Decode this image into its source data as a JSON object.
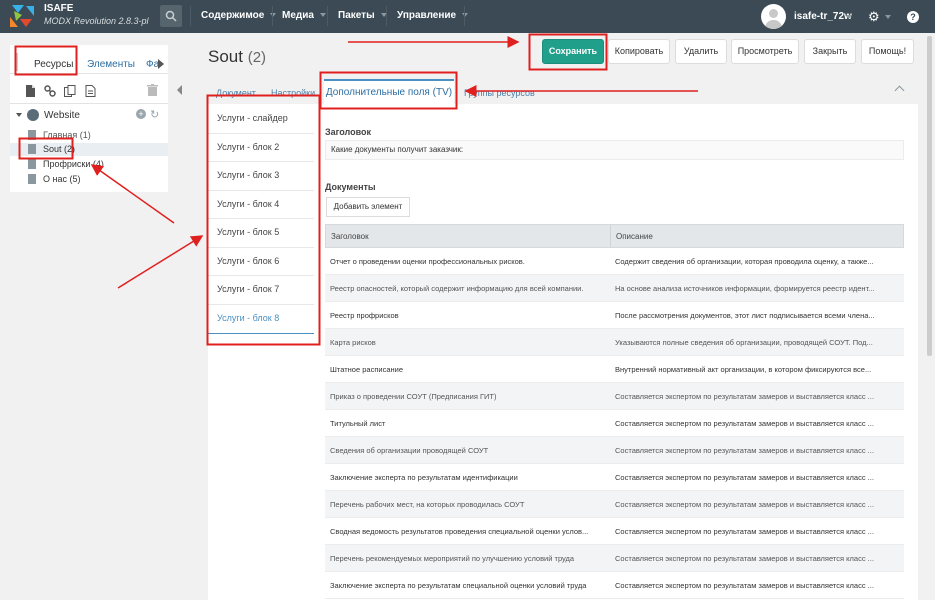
{
  "header": {
    "logo_title": "ISAFE",
    "logo_subtitle": "MODX Revolution 2.8.3-pl",
    "nav": [
      "Содержимое",
      "Медиа",
      "Пакеты",
      "Управление"
    ],
    "user": "isafe-tr_72w"
  },
  "left_panel": {
    "tabs": [
      "Ресурсы",
      "Элементы",
      "Фа"
    ],
    "tree_root": "Website",
    "tree_items": [
      "Главная (1)",
      "Sout (2)",
      "Профриски (4)",
      "О нас (5)"
    ]
  },
  "page": {
    "title": "Sout",
    "count": "(2)"
  },
  "toolbar": {
    "save": "Сохранить",
    "copy": "Копировать",
    "delete": "Удалить",
    "view": "Просмотреть",
    "close": "Закрыть",
    "help": "Помощь!"
  },
  "tabs": [
    "Документ",
    "Настройки",
    "Дополнительные поля (TV)",
    "Группы ресурсов"
  ],
  "vertical_tabs": [
    "Услуги - слайдер",
    "Услуги - блок 2",
    "Услуги - блок 3",
    "Услуги - блок 4",
    "Услуги - блок 5",
    "Услуги - блок 6",
    "Услуги - блок 7",
    "Услуги - блок 8"
  ],
  "content": {
    "heading_label": "Заголовок",
    "heading_value": "Какие документы получит заказчик:",
    "documents_label": "Документы",
    "add_button": "Добавить элемент",
    "columns": [
      "Заголовок",
      "Описание"
    ],
    "rows": [
      [
        "Отчет о проведении оценки профессиональных рисков.",
        "Содержит сведения об организации, которая проводила оценку, а также..."
      ],
      [
        "Реестр опасностей, который содержит информацию для всей компании.",
        "На основе анализа источников информации, формируется реестр идент..."
      ],
      [
        "Реестр профрисков",
        "После рассмотрения документов, этот лист подписывается всеми члена..."
      ],
      [
        "Карта рисков",
        "Указываются полные сведения об организации, проводящей СОУТ. Под..."
      ],
      [
        "Штатное расписание",
        "Внутренний нормативный акт организации, в котором фиксируются все..."
      ],
      [
        "Приказ о проведении СОУТ (Предписания ГИТ)",
        "Составляется экспертом по результатам замеров и выставляется класс ..."
      ],
      [
        "Титульный лист",
        "Составляется экспертом по результатам замеров и выставляется класс ..."
      ],
      [
        "Сведения об организации проводящей СОУТ",
        "Составляется экспертом по результатам замеров и выставляется класс ..."
      ],
      [
        "Заключение эксперта по результатам идентификации",
        "Составляется экспертом по результатам замеров и выставляется класс ..."
      ],
      [
        "Перечень рабочих мест, на которых проводилась СОУТ",
        "Составляется экспертом по результатам замеров и выставляется класс ..."
      ],
      [
        "Сводная ведомость результатов проведения специальной оценки услов...",
        "Составляется экспертом по результатам замеров и выставляется класс ..."
      ],
      [
        "Перечень рекомендуемых мероприятий по улучшению условий труда",
        "Составляется экспертом по результатам замеров и выставляется класс ..."
      ],
      [
        "Заключение эксперта по результатам специальной оценки условий труда",
        "Составляется экспертом по результатам замеров и выставляется класс ..."
      ]
    ]
  },
  "colors": {
    "topbar": "#3b4a54",
    "save": "#20a08a",
    "accent": "#4a90c2",
    "annotation": "#e0201f"
  }
}
